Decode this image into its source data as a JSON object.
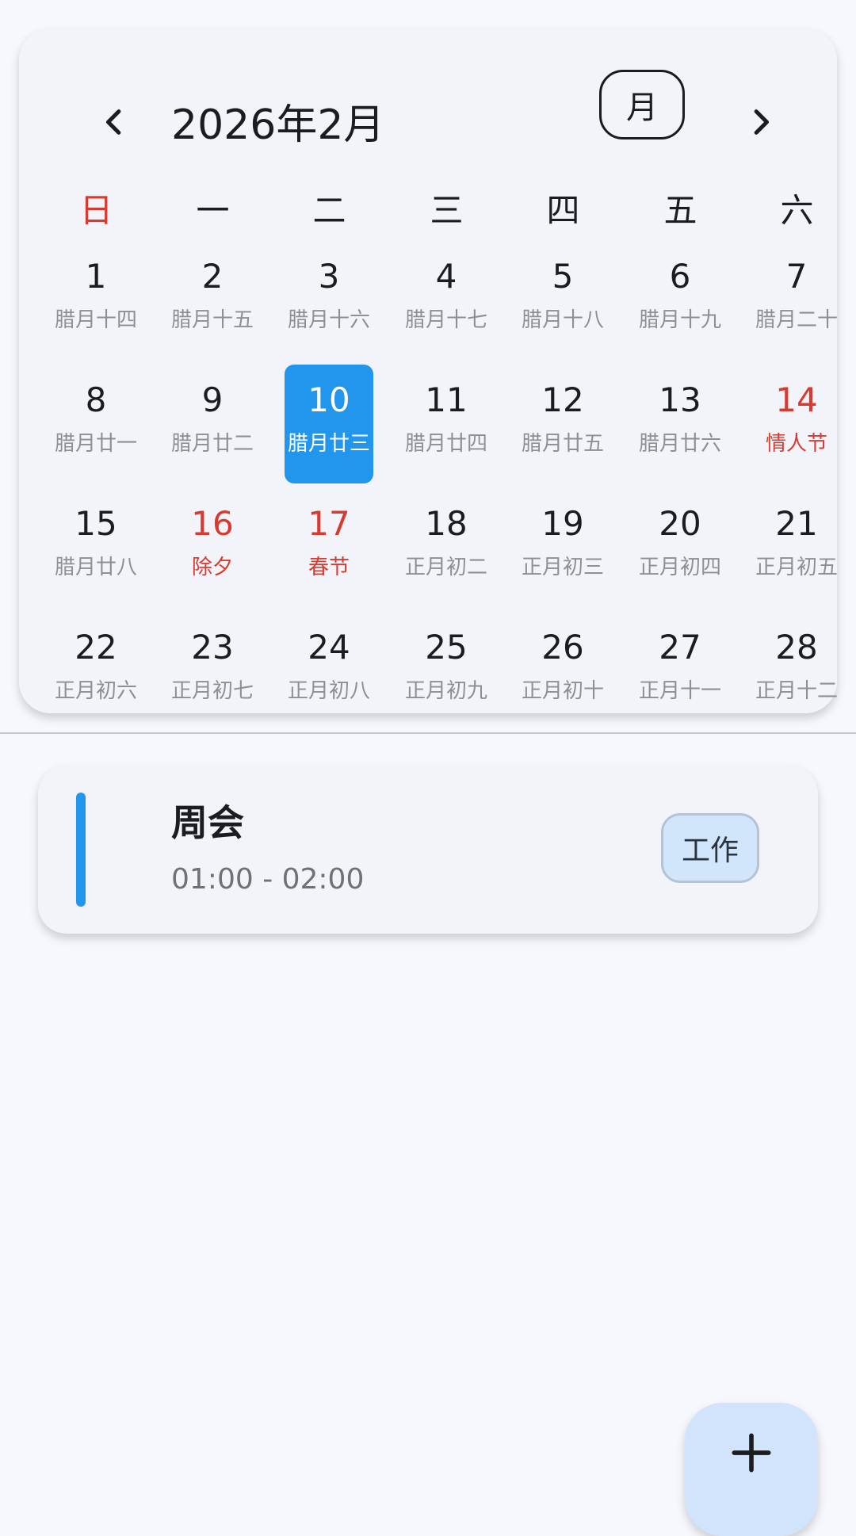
{
  "header": {
    "month_title": "2026年2月",
    "view_mode_label": "月",
    "prev_icon": "chevron-left-icon",
    "next_icon": "chevron-right-icon"
  },
  "weekdays": [
    "日",
    "一",
    "二",
    "三",
    "四",
    "五",
    "六"
  ],
  "weeks": [
    [
      {
        "day": "1",
        "sub": "腊月十四"
      },
      {
        "day": "2",
        "sub": "腊月十五"
      },
      {
        "day": "3",
        "sub": "腊月十六"
      },
      {
        "day": "4",
        "sub": "腊月十七"
      },
      {
        "day": "5",
        "sub": "腊月十八"
      },
      {
        "day": "6",
        "sub": "腊月十九"
      },
      {
        "day": "7",
        "sub": "腊月二十"
      }
    ],
    [
      {
        "day": "8",
        "sub": "腊月廿一"
      },
      {
        "day": "9",
        "sub": "腊月廿二"
      },
      {
        "day": "10",
        "sub": "腊月廿三",
        "selected": true
      },
      {
        "day": "11",
        "sub": "腊月廿四"
      },
      {
        "day": "12",
        "sub": "腊月廿五"
      },
      {
        "day": "13",
        "sub": "腊月廿六"
      },
      {
        "day": "14",
        "sub": "情人节",
        "holiday": true
      }
    ],
    [
      {
        "day": "15",
        "sub": "腊月廿八"
      },
      {
        "day": "16",
        "sub": "除夕",
        "holiday": true
      },
      {
        "day": "17",
        "sub": "春节",
        "holiday": true
      },
      {
        "day": "18",
        "sub": "正月初二"
      },
      {
        "day": "19",
        "sub": "正月初三"
      },
      {
        "day": "20",
        "sub": "正月初四"
      },
      {
        "day": "21",
        "sub": "正月初五"
      }
    ],
    [
      {
        "day": "22",
        "sub": "正月初六"
      },
      {
        "day": "23",
        "sub": "正月初七"
      },
      {
        "day": "24",
        "sub": "正月初八"
      },
      {
        "day": "25",
        "sub": "正月初九"
      },
      {
        "day": "26",
        "sub": "正月初十"
      },
      {
        "day": "27",
        "sub": "正月十一"
      },
      {
        "day": "28",
        "sub": "正月十二"
      }
    ]
  ],
  "events": [
    {
      "title": "周会",
      "time": "01:00 - 02:00",
      "tag": "工作"
    }
  ],
  "fab": {
    "icon": "plus-icon"
  },
  "colors": {
    "accent": "#2296ec",
    "holiday": "#d93a2f",
    "tag_bg": "#d2e6fb",
    "fab_bg": "#d2e4fb"
  }
}
